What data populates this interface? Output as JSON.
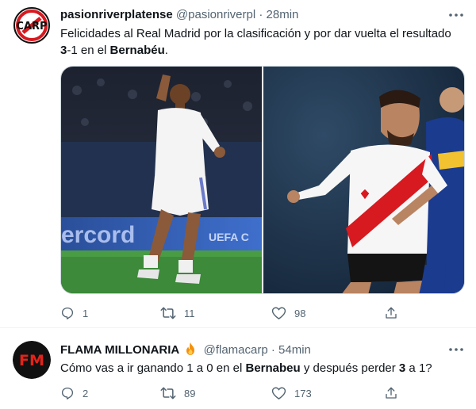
{
  "tweets": [
    {
      "display_name": "pasionriverplatense",
      "handle": "@pasionriverpl",
      "separator": "·",
      "time": "28min",
      "text_parts": [
        "Felicidades al Real Madrid por la clasificación y por dar vuelta el resultado ",
        "3",
        "-1 en el ",
        "Bernabéu",
        "."
      ],
      "media": {
        "left_banner_text": "ercord",
        "left_banner_text_2": "UEFA C"
      },
      "stats": {
        "replies": "1",
        "retweets": "11",
        "likes": "98"
      }
    },
    {
      "display_name": "FLAMA MILLONARIA",
      "handle": "@flamacarp",
      "separator": "·",
      "time": "54min",
      "avatar_text": "FM",
      "text_parts": [
        "Cómo vas a ir ganando 1 a 0 en el ",
        "Bernabeu",
        " y después perder ",
        "3",
        " a 1?"
      ],
      "stats": {
        "replies": "2",
        "retweets": "89",
        "likes": "173"
      }
    }
  ],
  "icons": {
    "reply": "reply-icon",
    "retweet": "retweet-icon",
    "like": "like-icon",
    "share": "share-icon",
    "more": "more-icon",
    "fire": "fire-icon"
  },
  "colors": {
    "text": "#0f1419",
    "muted": "#536471",
    "river_red": "#d71920",
    "fm_red": "#e2231a"
  }
}
